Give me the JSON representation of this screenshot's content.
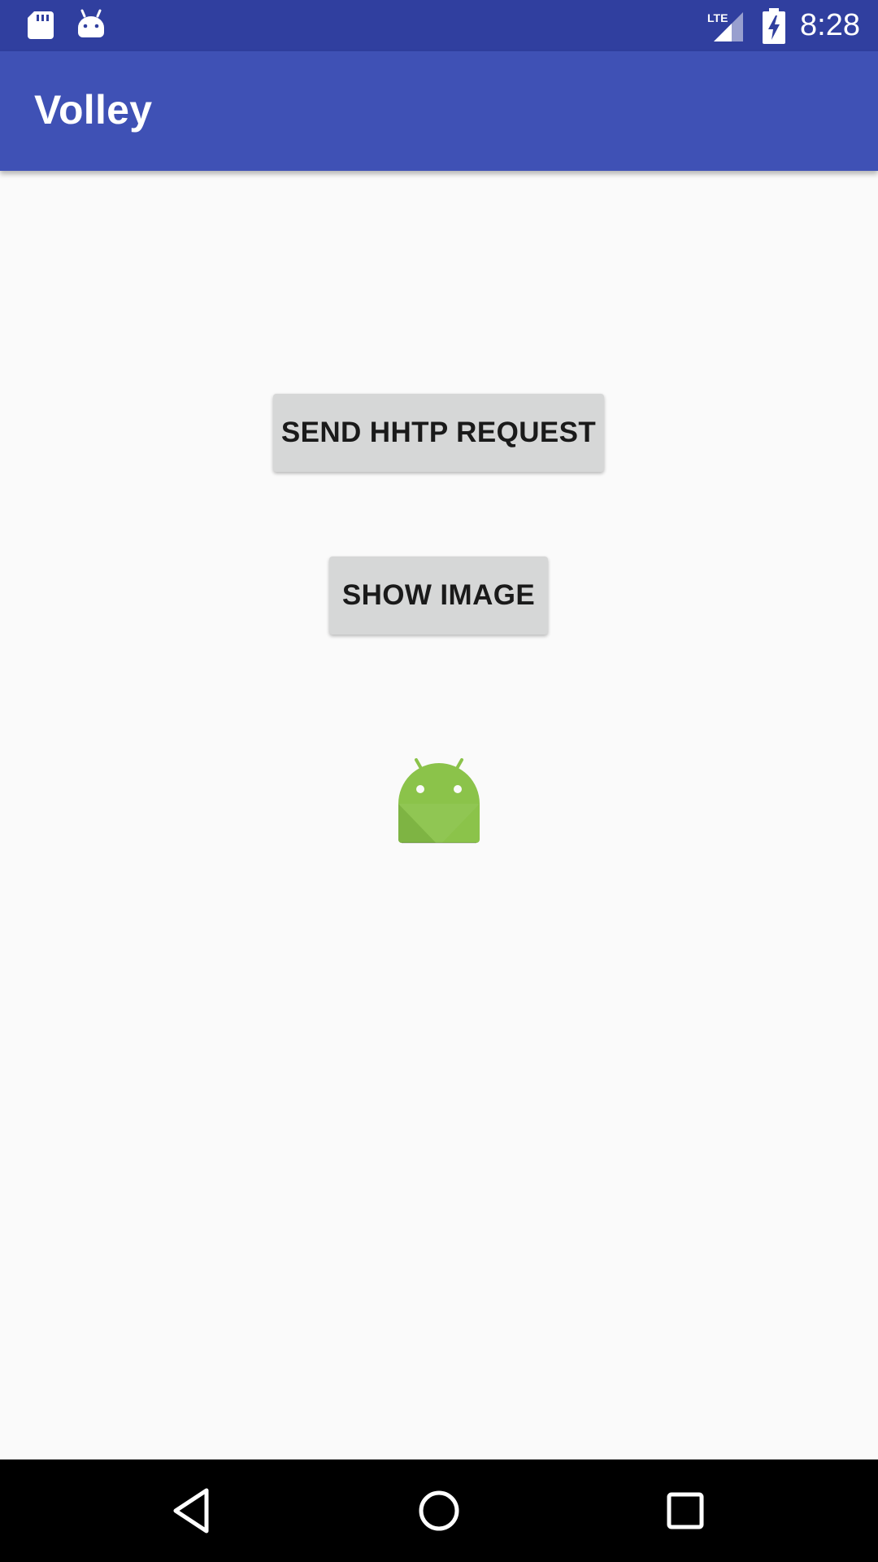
{
  "status_bar": {
    "time": "8:28",
    "network_label": "LTE",
    "icons": [
      "sd-card-icon",
      "android-notification-icon",
      "lte-signal-icon",
      "battery-charging-icon"
    ]
  },
  "app_bar": {
    "title": "Volley",
    "color": "#3f51b5",
    "status_color": "#303f9f"
  },
  "main": {
    "send_request_label": "SEND HHTP REQUEST",
    "show_image_label": "SHOW IMAGE",
    "image_icon": "android-robot-icon",
    "button_color": "#d6d7d7",
    "android_color": "#8bc34a"
  },
  "nav_bar": {
    "icons": [
      "back-icon",
      "home-icon",
      "recents-icon"
    ]
  }
}
